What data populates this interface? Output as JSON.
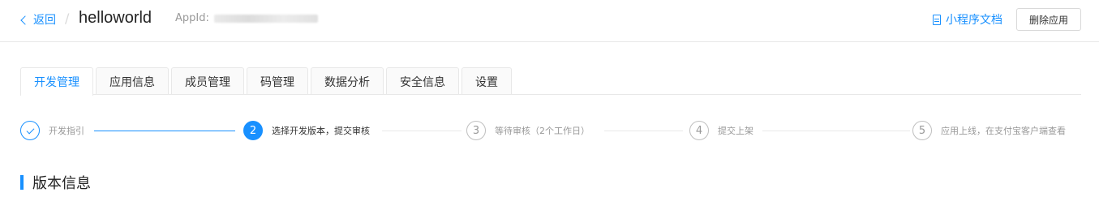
{
  "header": {
    "back_label": "返回",
    "breadcrumb_separator": "/",
    "app_name": "helloworld",
    "appid_label": "AppId:",
    "doc_link_label": "小程序文档",
    "delete_button_label": "删除应用"
  },
  "tabs": [
    {
      "label": "开发管理",
      "active": true
    },
    {
      "label": "应用信息",
      "active": false
    },
    {
      "label": "成员管理",
      "active": false
    },
    {
      "label": "码管理",
      "active": false
    },
    {
      "label": "数据分析",
      "active": false
    },
    {
      "label": "安全信息",
      "active": false
    },
    {
      "label": "设置",
      "active": false
    }
  ],
  "steps": [
    {
      "number": "",
      "title": "开发指引",
      "status": "done"
    },
    {
      "number": "2",
      "title": "选择开发版本，提交审核",
      "status": "current"
    },
    {
      "number": "3",
      "title": "等待审核（2个工作日）",
      "status": "wait"
    },
    {
      "number": "4",
      "title": "提交上架",
      "status": "wait"
    },
    {
      "number": "5",
      "title": "应用上线，在支付宝客户端查看",
      "status": "wait"
    }
  ],
  "section": {
    "title": "版本信息"
  },
  "colors": {
    "accent": "#1890ff",
    "border": "#e8e8e8",
    "muted_text": "#999999"
  }
}
